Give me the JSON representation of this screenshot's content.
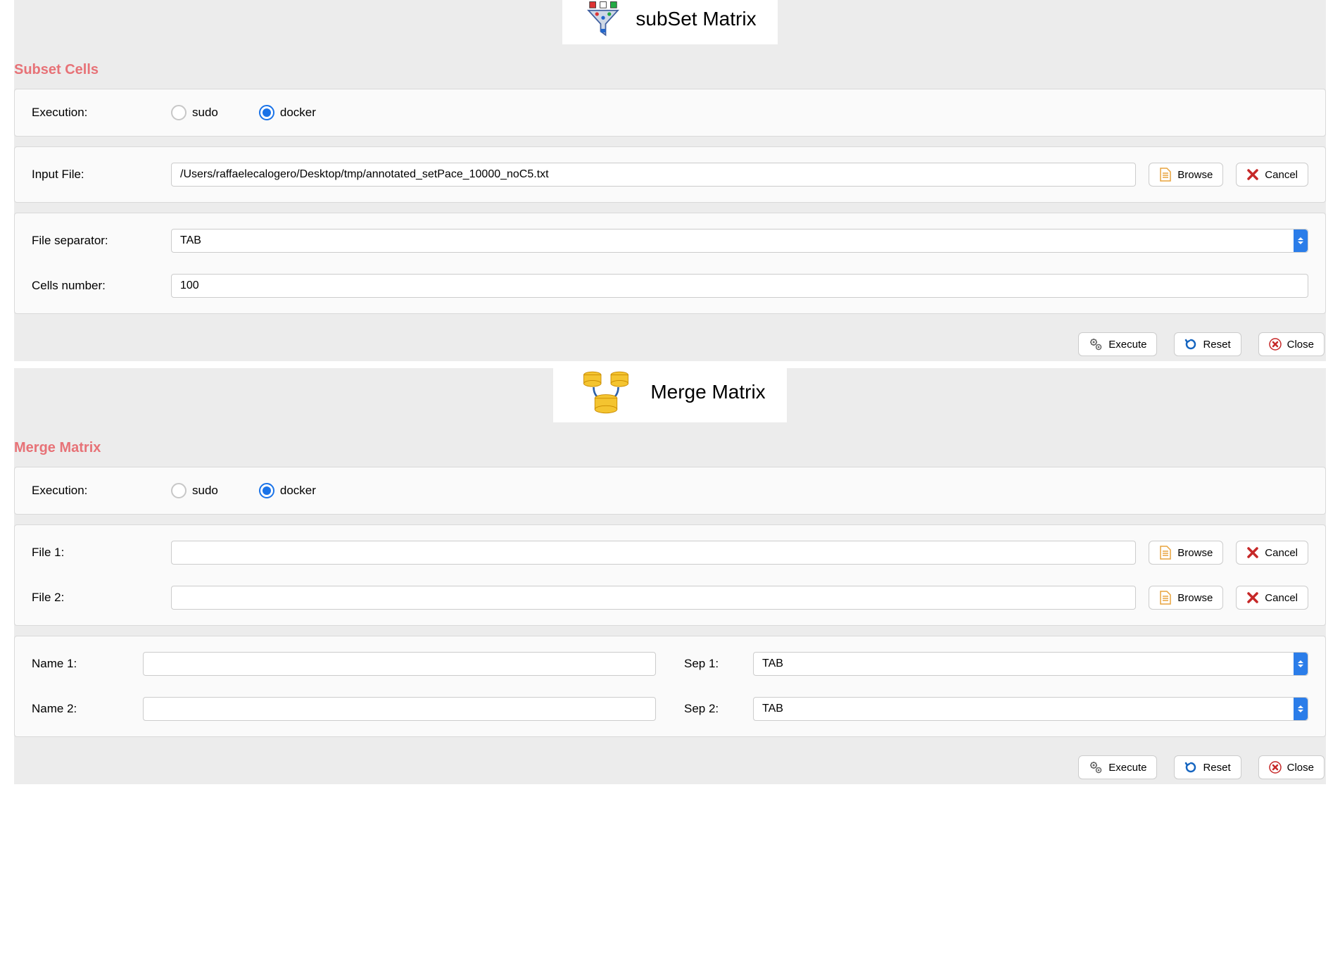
{
  "subset": {
    "section_title": "Subset Cells",
    "hero_label": "subSet Matrix",
    "execution_label": "Execution:",
    "radio_sudo": "sudo",
    "radio_docker": "docker",
    "input_file_label": "Input File:",
    "input_file_value": "/Users/raffaelecalogero/Desktop/tmp/annotated_setPace_10000_noC5.txt",
    "browse": "Browse",
    "cancel": "Cancel",
    "file_separator_label": "File separator:",
    "file_separator_value": "TAB",
    "cells_number_label": "Cells number:",
    "cells_number_value": "100",
    "execute": "Execute",
    "reset": "Reset",
    "close": "Close"
  },
  "merge": {
    "section_title": "Merge Matrix",
    "hero_label": "Merge Matrix",
    "execution_label": "Execution:",
    "radio_sudo": "sudo",
    "radio_docker": "docker",
    "file1_label": "File 1:",
    "file1_value": "",
    "file2_label": "File 2:",
    "file2_value": "",
    "browse": "Browse",
    "cancel": "Cancel",
    "name1_label": "Name 1:",
    "name1_value": "",
    "name2_label": "Name 2:",
    "name2_value": "",
    "sep1_label": "Sep 1:",
    "sep1_value": "TAB",
    "sep2_label": "Sep 2:",
    "sep2_value": "TAB",
    "execute": "Execute",
    "reset": "Reset",
    "close": "Close"
  }
}
